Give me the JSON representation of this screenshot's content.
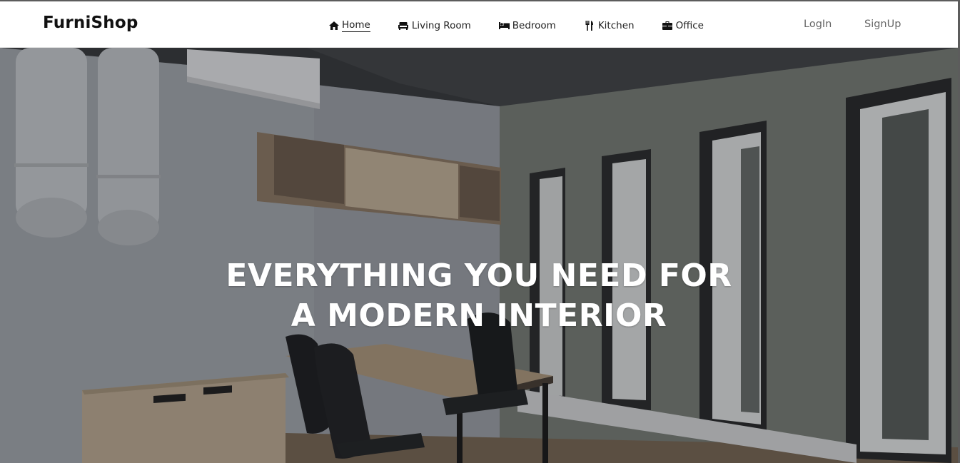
{
  "brand": {
    "name": "FurniShop"
  },
  "nav": {
    "items": [
      {
        "label": "Home",
        "icon": "home-icon",
        "active": true
      },
      {
        "label": "Living Room",
        "icon": "sofa-icon",
        "active": false
      },
      {
        "label": "Bedroom",
        "icon": "bed-icon",
        "active": false
      },
      {
        "label": "Kitchen",
        "icon": "cutlery-icon",
        "active": false
      },
      {
        "label": "Office",
        "icon": "briefcase-icon",
        "active": false
      }
    ]
  },
  "auth": {
    "login_label": "LogIn",
    "signup_label": "SignUp"
  },
  "hero": {
    "headline_line1": "EVERYTHING YOU NEED FOR",
    "headline_line2": "A MODERN INTERIOR",
    "image": "office-interior-photo"
  },
  "colors": {
    "navbar_bg": "#ffffff",
    "text_dark": "#111111",
    "auth_text": "#666666",
    "hero_text": "#ffffff"
  }
}
